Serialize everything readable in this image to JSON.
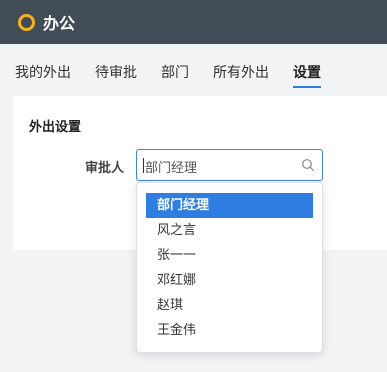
{
  "app": {
    "title": "办公"
  },
  "tabs": [
    {
      "label": "我的外出",
      "active": false
    },
    {
      "label": "待审批",
      "active": false
    },
    {
      "label": "部门",
      "active": false
    },
    {
      "label": "所有外出",
      "active": false
    },
    {
      "label": "设置",
      "active": true
    }
  ],
  "settings": {
    "section_title": "外出设置",
    "approver_label": "审批人",
    "approver_value": "部门经理"
  },
  "dropdown": {
    "options": [
      "部门经理",
      "风之言",
      "张一一",
      "邓红娜",
      "赵琪",
      "王金伟"
    ],
    "selected": "部门经理"
  },
  "colors": {
    "topbar": "#424c57",
    "accent": "#2f7de1",
    "logo": "#f5b31b"
  }
}
